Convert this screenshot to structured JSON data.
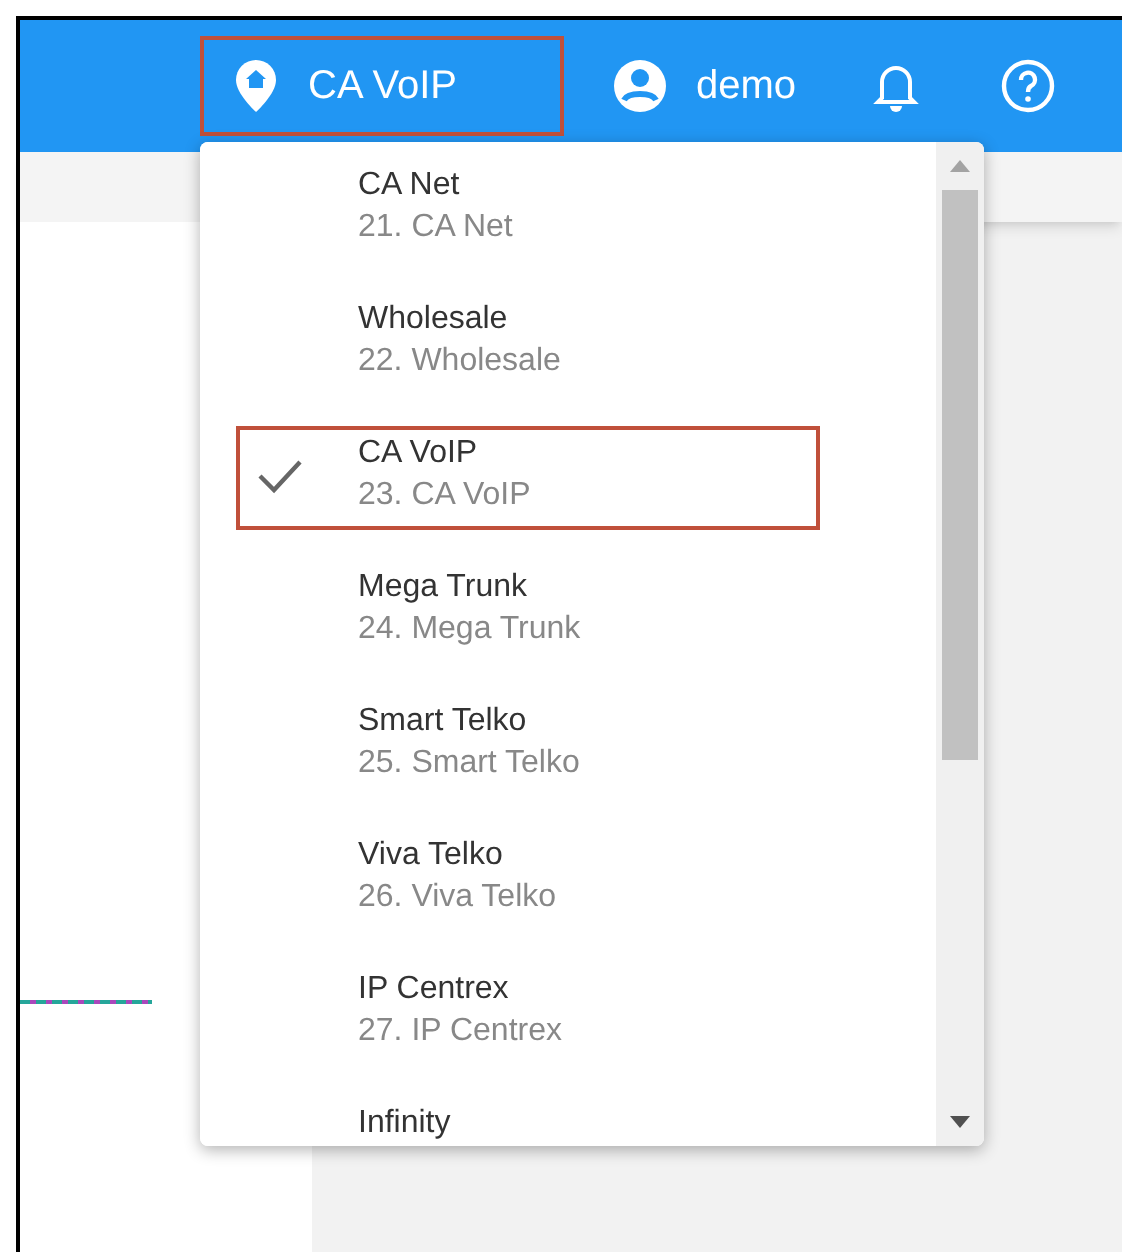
{
  "header": {
    "location": {
      "label": "CA VoIP",
      "annotated": true
    },
    "user": {
      "label": "demo"
    }
  },
  "menu": {
    "items": [
      {
        "title": "CA Net",
        "subtitle": "21. CA Net",
        "selected": false
      },
      {
        "title": "Wholesale",
        "subtitle": "22. Wholesale",
        "selected": false
      },
      {
        "title": "CA VoIP",
        "subtitle": "23. CA VoIP",
        "selected": true
      },
      {
        "title": "Mega Trunk",
        "subtitle": "24. Mega Trunk",
        "selected": false
      },
      {
        "title": "Smart Telko",
        "subtitle": "25. Smart Telko",
        "selected": false
      },
      {
        "title": "Viva Telko",
        "subtitle": "26. Viva Telko",
        "selected": false
      },
      {
        "title": "IP Centrex",
        "subtitle": "27. IP Centrex",
        "selected": false
      },
      {
        "title": "Infinity",
        "selected": false
      }
    ]
  }
}
